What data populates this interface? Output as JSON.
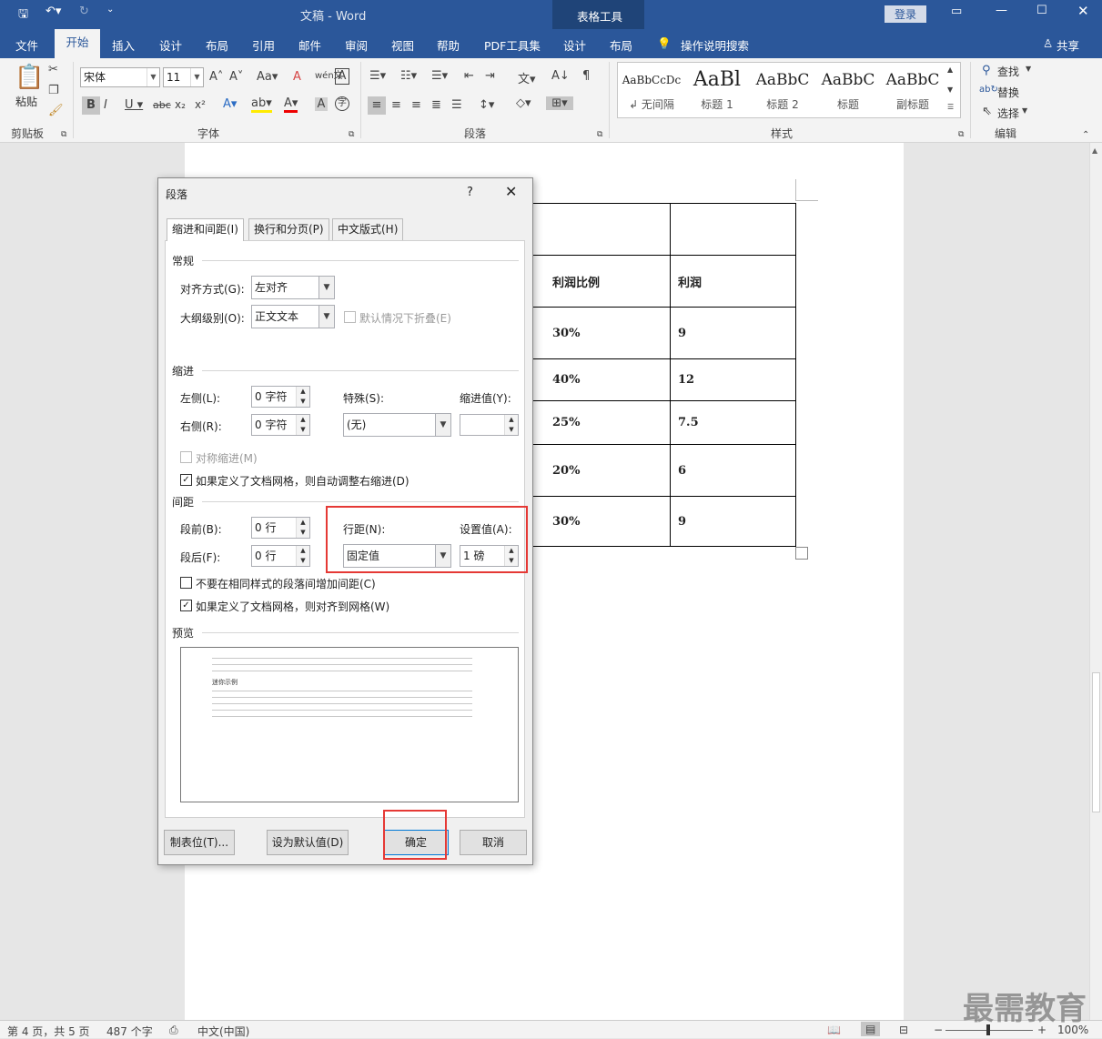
{
  "window": {
    "title": "文稿 - Word",
    "context_tab": "表格工具",
    "login": "登录"
  },
  "tabs": [
    "文件",
    "开始",
    "插入",
    "设计",
    "布局",
    "引用",
    "邮件",
    "审阅",
    "视图",
    "帮助",
    "PDF工具集",
    "设计",
    "布局"
  ],
  "tell_me": "操作说明搜索",
  "share": "共享",
  "ribbon": {
    "paste": "粘贴",
    "font_name": "宋体",
    "font_size": "11",
    "styles": [
      {
        "preview": "AaBbCcDc",
        "name": "↲ 无间隔"
      },
      {
        "preview": "AaBl",
        "name": "标题 1"
      },
      {
        "preview": "AaBbC",
        "name": "标题 2"
      },
      {
        "preview": "AaBbC",
        "name": "标题"
      },
      {
        "preview": "AaBbC",
        "name": "副标题"
      }
    ],
    "find": "查找",
    "replace": "替换",
    "select": "选择",
    "groups": {
      "clipboard": "剪贴板",
      "font": "字体",
      "paragraph": "段落",
      "styles": "样式",
      "editing": "编辑"
    }
  },
  "table": {
    "rows": [
      [
        "",
        ""
      ],
      [
        "利润比例",
        "利润"
      ],
      [
        "30%",
        "9"
      ],
      [
        "40%",
        "12"
      ],
      [
        "25%",
        "7.5"
      ],
      [
        "20%",
        "6"
      ],
      [
        "30%",
        "9"
      ]
    ]
  },
  "dialog": {
    "title": "段落",
    "help": "?",
    "tabs": [
      "缩进和间距(I)",
      "换行和分页(P)",
      "中文版式(H)"
    ],
    "general": "常规",
    "alignment_label": "对齐方式(G):",
    "alignment_value": "左对齐",
    "outline_label": "大纲级别(O):",
    "outline_value": "正文文本",
    "collapse_label": "默认情况下折叠(E)",
    "indent": "缩进",
    "left_label": "左侧(L):",
    "left_value": "0 字符",
    "right_label": "右侧(R):",
    "right_value": "0 字符",
    "special_label": "特殊(S):",
    "special_value": "(无)",
    "indent_by_label": "缩进值(Y):",
    "indent_by_value": "",
    "mirror_label": "对称缩进(M)",
    "auto_right_label": "如果定义了文档网格，则自动调整右缩进(D)",
    "spacing": "间距",
    "before_label": "段前(B):",
    "before_value": "0 行",
    "after_label": "段后(F):",
    "after_value": "0 行",
    "line_spacing_label": "行距(N):",
    "line_spacing_value": "固定值",
    "at_label": "设置值(A):",
    "at_value": "1 磅",
    "no_space_label": "不要在相同样式的段落间增加间距(C)",
    "snap_grid_label": "如果定义了文档网格，则对齐到网格(W)",
    "preview": "预览",
    "preview_sample": "迷你示例",
    "tabs_button": "制表位(T)...",
    "default_button": "设为默认值(D)",
    "ok_button": "确定",
    "cancel_button": "取消"
  },
  "status": {
    "page": "第 4 页，共 5 页",
    "words": "487 个字",
    "lang": "中文(中国)",
    "zoom": "100%"
  },
  "watermark": "最需教育"
}
